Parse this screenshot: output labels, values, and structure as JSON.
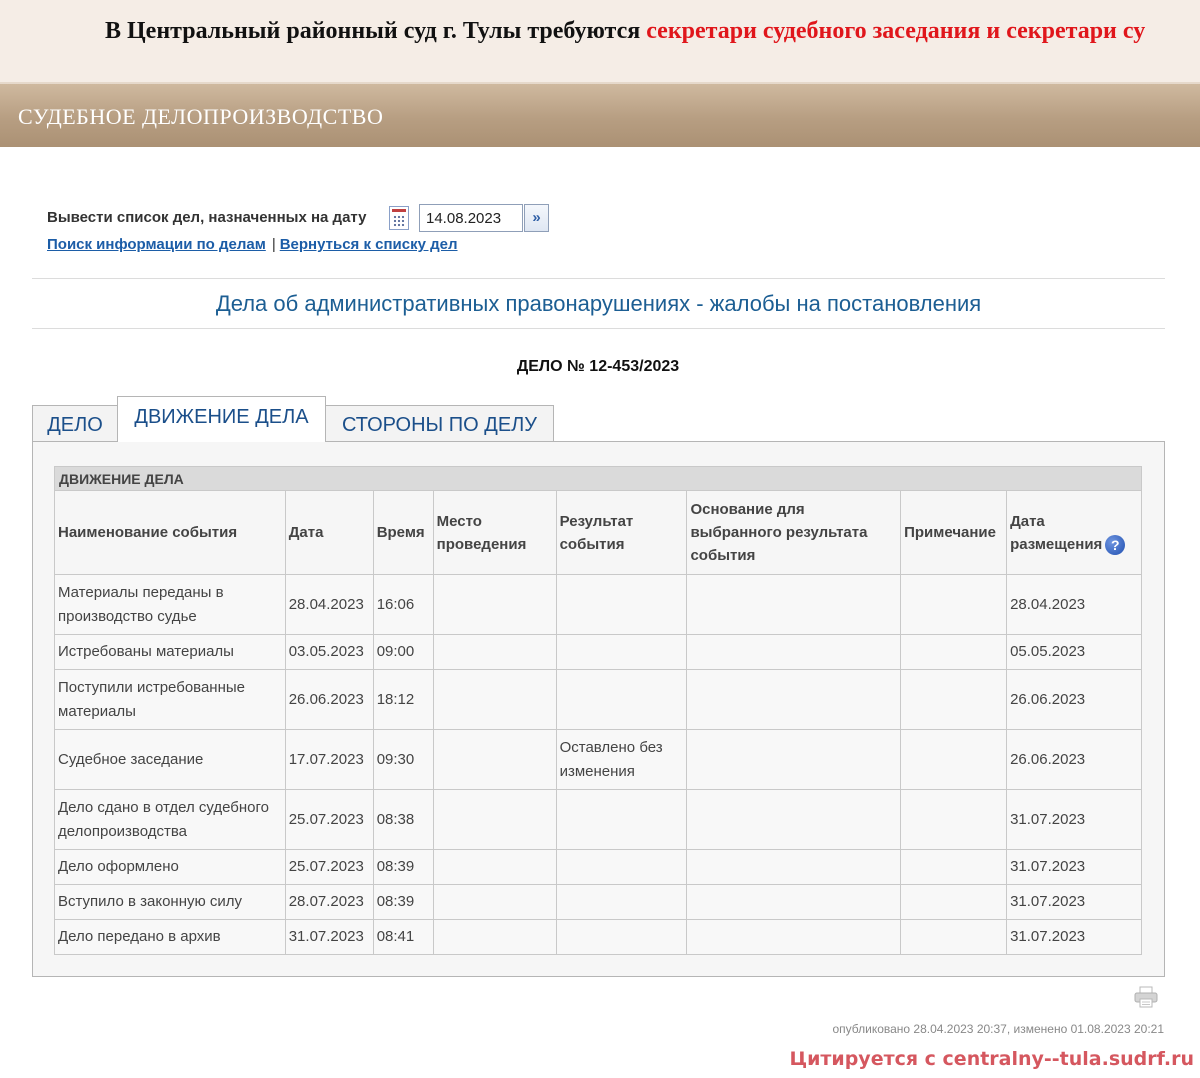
{
  "announcement": {
    "text_prefix": "В Центральный районный суд г. Тулы требуются ",
    "text_highlight": "секретари судебного заседания и секретари су"
  },
  "section": {
    "title": "СУДЕБНОЕ ДЕЛОПРОИЗВОДСТВО"
  },
  "date_filter": {
    "label": "Вывести список дел, назначенных на дату",
    "date_value": "14.08.2023",
    "go_label": "»"
  },
  "links": {
    "search": "Поиск информации по делам",
    "separator": "|",
    "back": "Вернуться к списку дел"
  },
  "category_title": "Дела об административных правонарушениях - жалобы на постановления",
  "case_number": "ДЕЛО № 12-453/2023",
  "tabs": [
    {
      "label": "ДЕЛО",
      "active": false
    },
    {
      "label": "ДВИЖЕНИЕ ДЕЛА",
      "active": true
    },
    {
      "label": "СТОРОНЫ ПО ДЕЛУ",
      "active": false
    }
  ],
  "movement": {
    "caption": "ДВИЖЕНИЕ ДЕЛА",
    "columns": [
      "Наименование события",
      "Дата",
      "Время",
      "Место проведения",
      "Результат события",
      "Основание для выбранного результата события",
      "Примечание",
      "Дата размещения"
    ],
    "help_icon": "question-icon",
    "rows": [
      [
        "Материалы переданы в производство судье",
        "28.04.2023",
        "16:06",
        "",
        "",
        "",
        "",
        "28.04.2023"
      ],
      [
        "Истребованы материалы",
        "03.05.2023",
        "09:00",
        "",
        "",
        "",
        "",
        "05.05.2023"
      ],
      [
        "Поступили истребованные материалы",
        "26.06.2023",
        "18:12",
        "",
        "",
        "",
        "",
        "26.06.2023"
      ],
      [
        "Судебное заседание",
        "17.07.2023",
        "09:30",
        "",
        "Оставлено без изменения",
        "",
        "",
        "26.06.2023"
      ],
      [
        "Дело сдано в отдел судебного делопроизводства",
        "25.07.2023",
        "08:38",
        "",
        "",
        "",
        "",
        "31.07.2023"
      ],
      [
        "Дело оформлено",
        "25.07.2023",
        "08:39",
        "",
        "",
        "",
        "",
        "31.07.2023"
      ],
      [
        "Вступило в законную силу",
        "28.07.2023",
        "08:39",
        "",
        "",
        "",
        "",
        "31.07.2023"
      ],
      [
        "Дело передано в архив",
        "31.07.2023",
        "08:41",
        "",
        "",
        "",
        "",
        "31.07.2023"
      ]
    ]
  },
  "footer": {
    "print_icon": "printer-icon",
    "published": "опубликовано 28.04.2023 20:37, изменено 01.08.2023 20:21",
    "watermark": "Цитируется с centralny--tula.sudrf.ru"
  }
}
